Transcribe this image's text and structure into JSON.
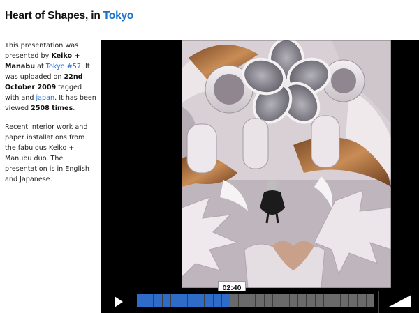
{
  "header": {
    "title_prefix": "Heart of Shapes, in ",
    "title_link": "Tokyo"
  },
  "info": {
    "p1_a": "This presentation was presented by ",
    "presenter": "Keiko + Manabu",
    "p1_b": " at ",
    "event_link": "Tokyo #57",
    "p1_c": ". It was uploaded on ",
    "upload_date": "22nd October 2009",
    "p1_d": " tagged with and ",
    "tag_link": "japan",
    "p1_e": ". It has been viewed ",
    "views": "2508 times",
    "p1_f": ".",
    "description": "Recent interior work and paper installations from the fabulous Keiko + Manubu duo. The presentation is in English and Japanese."
  },
  "player": {
    "current_time": "02:40",
    "segments_total": 28,
    "segments_played": 11,
    "progress_fraction": 0.39,
    "colors": {
      "played": "#2e6cc8",
      "unplayed": "#6a6a6a",
      "background": "#000000"
    },
    "icons": {
      "play": "play-icon",
      "volume": "volume-icon"
    }
  }
}
